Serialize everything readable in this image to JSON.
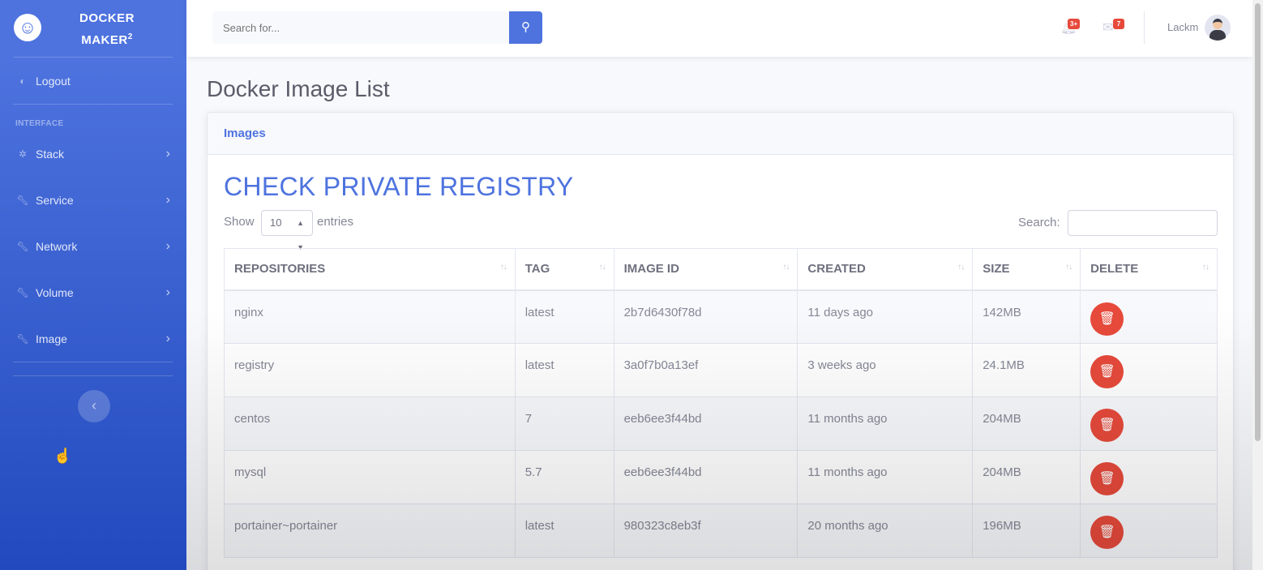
{
  "brand": {
    "line1": "DOCKER",
    "line2": "MAKER",
    "sup": "2",
    "icon": "laugh-wink-icon"
  },
  "sidebar": {
    "logout": {
      "label": "Logout",
      "icon": "dashboard-icon"
    },
    "heading": "INTERFACE",
    "items": [
      {
        "label": "Stack",
        "icon": "cog-icon"
      },
      {
        "label": "Service",
        "icon": "wrench-icon"
      },
      {
        "label": "Network",
        "icon": "wrench-icon"
      },
      {
        "label": "Volume",
        "icon": "wrench-icon"
      },
      {
        "label": "Image",
        "icon": "wrench-icon"
      }
    ],
    "toggle": "‹"
  },
  "topbar": {
    "search_placeholder": "Search for...",
    "alerts_badge": "3+",
    "messages_badge": "7",
    "user_name": "Lackm"
  },
  "page": {
    "title": "Docker Image List",
    "card_header": "Images",
    "section_title": "CHECK PRIVATE REGISTRY",
    "show_label": "Show",
    "page_length": "10",
    "entries_label": "entries",
    "search_label": "Search:"
  },
  "table": {
    "columns": [
      "REPOSITORIES",
      "TAG",
      "IMAGE ID",
      "CREATED",
      "SIZE",
      "DELETE"
    ],
    "rows": [
      [
        "nginx",
        "latest",
        "2b7d6430f78d",
        "11 days ago",
        "142MB"
      ],
      [
        "registry",
        "latest",
        "3a0f7b0a13ef",
        "3 weeks ago",
        "24.1MB"
      ],
      [
        "centos",
        "7",
        "eeb6ee3f44bd",
        "11 months ago",
        "204MB"
      ],
      [
        "mysql",
        "5.7",
        "eeb6ee3f44bd",
        "11 months ago",
        "204MB"
      ],
      [
        "portainer~portainer",
        "latest",
        "980323c8eb3f",
        "20 months ago",
        "196MB"
      ]
    ]
  },
  "colors": {
    "primary": "#4e73df",
    "danger": "#e74a3b",
    "sidebar_dark": "#224abe"
  }
}
